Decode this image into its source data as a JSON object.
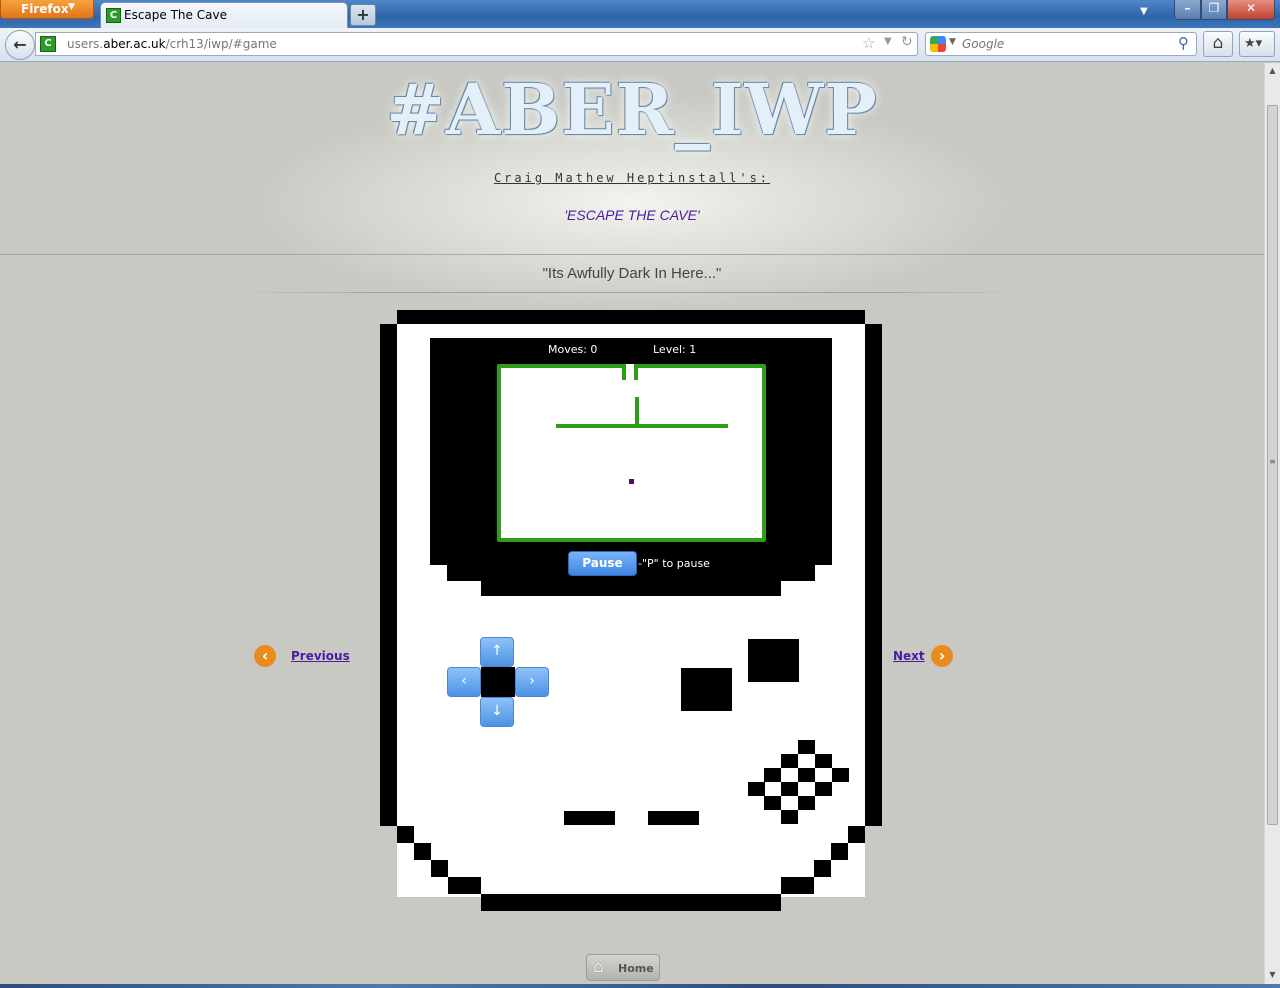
{
  "browser": {
    "menu_button": "Firefox",
    "tab_title": "Escape The Cave",
    "tab_favicon_letter": "C",
    "new_tab_symbol": "+",
    "url_domain_prefix": "users.",
    "url_domain": "aber.ac.uk",
    "url_path": "/crh13/iwp/#game",
    "search_engine": "Google",
    "search_placeholder": "Google"
  },
  "page": {
    "logo": "#ABER_IWP",
    "author_line": "Craig Mathew Heptinstall's:",
    "game_title": "'ESCAPE THE CAVE'",
    "tagline": "\"Its Awfully Dark In Here...\""
  },
  "game": {
    "moves_label": "Moves: 0",
    "level_label": "Level: 1",
    "moves": 0,
    "level": 1,
    "pause_button": "Pause",
    "pause_hint": "-\"P\" to pause",
    "dpad": {
      "up": "↑",
      "down": "↓",
      "left": "‹",
      "right": "›"
    }
  },
  "navigation": {
    "previous": "Previous",
    "next": "Next",
    "home": "Home"
  },
  "colors": {
    "accent_orange": "#e98b1d",
    "link_purple": "#4b1aa0",
    "cave_wall_green": "#2e9d18",
    "button_blue": "#4d93e6",
    "page_background": "#c9c9c3"
  },
  "icons": {
    "back": "back-arrow-icon",
    "bookmark_star": "star-icon",
    "reload": "reload-icon",
    "search": "magnifier-icon",
    "home": "home-icon",
    "bookmarks": "bookmarks-icon",
    "previous": "chevron-left-icon",
    "next": "chevron-right-icon"
  }
}
